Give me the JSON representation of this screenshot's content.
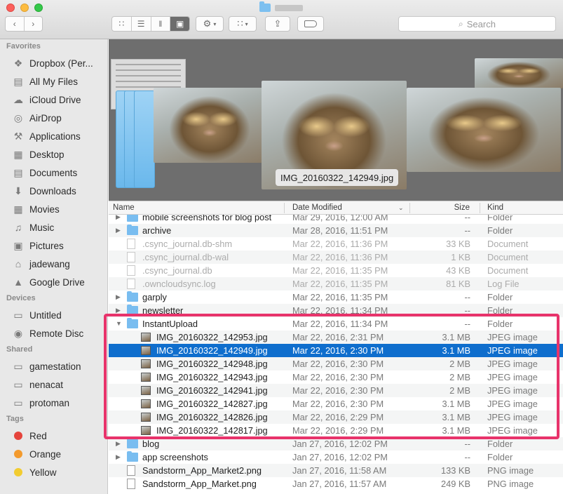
{
  "window": {
    "title_blurred": ""
  },
  "toolbar": {
    "back_icon": "chevron-left-icon",
    "forward_icon": "chevron-right-icon",
    "views": [
      "icon-view",
      "list-view",
      "column-view",
      "cover-flow-view"
    ],
    "action_icon": "gear-icon",
    "arrange_icon": "grid-arrange-icon",
    "share_icon": "share-icon",
    "tag_icon": "tag-icon",
    "search_placeholder": "Search"
  },
  "sidebar": {
    "favorites_label": "Favorites",
    "favorites": [
      {
        "label": "Dropbox (Per...",
        "icon": "dropbox-icon"
      },
      {
        "label": "All My Files",
        "icon": "all-files-icon"
      },
      {
        "label": "iCloud Drive",
        "icon": "cloud-icon"
      },
      {
        "label": "AirDrop",
        "icon": "airdrop-icon"
      },
      {
        "label": "Applications",
        "icon": "applications-icon"
      },
      {
        "label": "Desktop",
        "icon": "desktop-icon"
      },
      {
        "label": "Documents",
        "icon": "documents-icon"
      },
      {
        "label": "Downloads",
        "icon": "downloads-icon"
      },
      {
        "label": "Movies",
        "icon": "movies-icon"
      },
      {
        "label": "Music",
        "icon": "music-icon"
      },
      {
        "label": "Pictures",
        "icon": "pictures-icon"
      },
      {
        "label": "jadewang",
        "icon": "home-icon"
      },
      {
        "label": "Google Drive",
        "icon": "google-drive-icon"
      }
    ],
    "devices_label": "Devices",
    "devices": [
      {
        "label": "Untitled",
        "icon": "disk-icon"
      },
      {
        "label": "Remote Disc",
        "icon": "remote-disc-icon"
      }
    ],
    "shared_label": "Shared",
    "shared": [
      {
        "label": "gamestation",
        "icon": "computer-icon"
      },
      {
        "label": "nenacat",
        "icon": "computer-icon"
      },
      {
        "label": "protoman",
        "icon": "computer-icon"
      }
    ],
    "tags_label": "Tags",
    "tags": [
      {
        "label": "Red",
        "color": "#e5443c"
      },
      {
        "label": "Orange",
        "color": "#f39a2d"
      },
      {
        "label": "Yellow",
        "color": "#f2cc30"
      }
    ]
  },
  "coverflow": {
    "caption": "IMG_20160322_142949.jpg"
  },
  "columns": {
    "name": "Name",
    "date": "Date Modified",
    "size": "Size",
    "kind": "Kind"
  },
  "rows": [
    {
      "disc": "▶",
      "icon": "folder",
      "name": "mobile screenshots for blog post",
      "date": "Mar 29, 2016, 12:00 AM",
      "size": "--",
      "kind": "Folder",
      "indent": 0,
      "dim": false
    },
    {
      "disc": "▶",
      "icon": "folder",
      "name": "archive",
      "date": "Mar 28, 2016, 11:51 PM",
      "size": "--",
      "kind": "Folder",
      "indent": 0,
      "dim": false
    },
    {
      "disc": "",
      "icon": "doc",
      "name": ".csync_journal.db-shm",
      "date": "Mar 22, 2016, 11:36 PM",
      "size": "33 KB",
      "kind": "Document",
      "indent": 0,
      "dim": true
    },
    {
      "disc": "",
      "icon": "doc",
      "name": ".csync_journal.db-wal",
      "date": "Mar 22, 2016, 11:36 PM",
      "size": "1 KB",
      "kind": "Document",
      "indent": 0,
      "dim": true
    },
    {
      "disc": "",
      "icon": "doc",
      "name": ".csync_journal.db",
      "date": "Mar 22, 2016, 11:35 PM",
      "size": "43 KB",
      "kind": "Document",
      "indent": 0,
      "dim": true
    },
    {
      "disc": "",
      "icon": "doc",
      "name": ".owncloudsync.log",
      "date": "Mar 22, 2016, 11:35 PM",
      "size": "81 KB",
      "kind": "Log File",
      "indent": 0,
      "dim": true
    },
    {
      "disc": "▶",
      "icon": "folder",
      "name": "garply",
      "date": "Mar 22, 2016, 11:35 PM",
      "size": "--",
      "kind": "Folder",
      "indent": 0,
      "dim": false
    },
    {
      "disc": "▶",
      "icon": "folder",
      "name": "newsletter",
      "date": "Mar 22, 2016, 11:34 PM",
      "size": "--",
      "kind": "Folder",
      "indent": 0,
      "dim": false
    },
    {
      "disc": "▼",
      "icon": "folder",
      "name": "InstantUpload",
      "date": "Mar 22, 2016, 11:34 PM",
      "size": "--",
      "kind": "Folder",
      "indent": 0,
      "dim": false
    },
    {
      "disc": "",
      "icon": "img",
      "name": "IMG_20160322_142953.jpg",
      "date": "Mar 22, 2016, 2:31 PM",
      "size": "3.1 MB",
      "kind": "JPEG image",
      "indent": 1,
      "dim": false
    },
    {
      "disc": "",
      "icon": "img",
      "name": "IMG_20160322_142949.jpg",
      "date": "Mar 22, 2016, 2:30 PM",
      "size": "3.1 MB",
      "kind": "JPEG image",
      "indent": 1,
      "dim": false,
      "selected": true
    },
    {
      "disc": "",
      "icon": "img",
      "name": "IMG_20160322_142948.jpg",
      "date": "Mar 22, 2016, 2:30 PM",
      "size": "2 MB",
      "kind": "JPEG image",
      "indent": 1,
      "dim": false
    },
    {
      "disc": "",
      "icon": "img",
      "name": "IMG_20160322_142943.jpg",
      "date": "Mar 22, 2016, 2:30 PM",
      "size": "2 MB",
      "kind": "JPEG image",
      "indent": 1,
      "dim": false
    },
    {
      "disc": "",
      "icon": "img",
      "name": "IMG_20160322_142941.jpg",
      "date": "Mar 22, 2016, 2:30 PM",
      "size": "2 MB",
      "kind": "JPEG image",
      "indent": 1,
      "dim": false
    },
    {
      "disc": "",
      "icon": "img",
      "name": "IMG_20160322_142827.jpg",
      "date": "Mar 22, 2016, 2:30 PM",
      "size": "3.1 MB",
      "kind": "JPEG image",
      "indent": 1,
      "dim": false
    },
    {
      "disc": "",
      "icon": "img",
      "name": "IMG_20160322_142826.jpg",
      "date": "Mar 22, 2016, 2:29 PM",
      "size": "3.1 MB",
      "kind": "JPEG image",
      "indent": 1,
      "dim": false
    },
    {
      "disc": "",
      "icon": "img",
      "name": "IMG_20160322_142817.jpg",
      "date": "Mar 22, 2016, 2:29 PM",
      "size": "3.1 MB",
      "kind": "JPEG image",
      "indent": 1,
      "dim": false
    },
    {
      "disc": "▶",
      "icon": "folder",
      "name": "blog",
      "date": "Jan 27, 2016, 12:02 PM",
      "size": "--",
      "kind": "Folder",
      "indent": 0,
      "dim": false
    },
    {
      "disc": "▶",
      "icon": "folder",
      "name": "app screenshots",
      "date": "Jan 27, 2016, 12:02 PM",
      "size": "--",
      "kind": "Folder",
      "indent": 0,
      "dim": false
    },
    {
      "disc": "",
      "icon": "png",
      "name": "Sandstorm_App_Market2.png",
      "date": "Jan 27, 2016, 11:58 AM",
      "size": "133 KB",
      "kind": "PNG image",
      "indent": 0,
      "dim": false
    },
    {
      "disc": "",
      "icon": "png",
      "name": "Sandstorm_App_Market.png",
      "date": "Jan 27, 2016, 11:57 AM",
      "size": "249 KB",
      "kind": "PNG image",
      "indent": 0,
      "dim": false
    }
  ]
}
